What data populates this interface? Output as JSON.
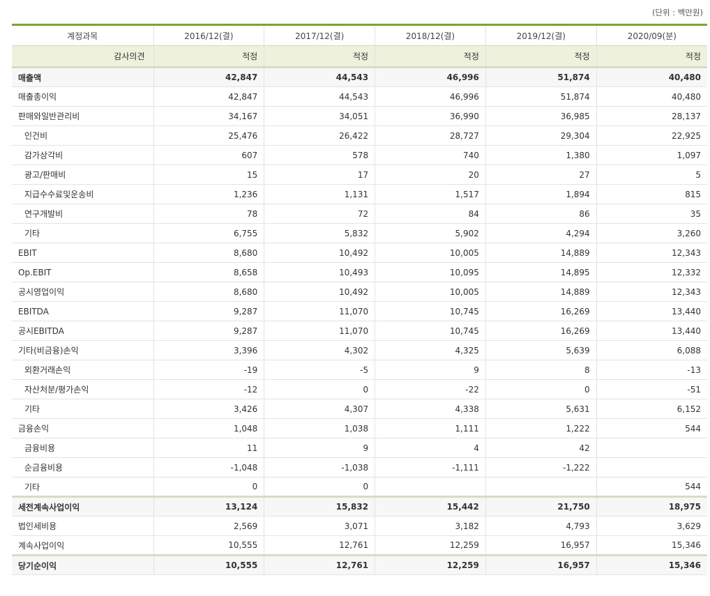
{
  "unit_label": "(단위 : 백만원)",
  "header": {
    "account_label": "계정과목",
    "periods": [
      "2016/12(결)",
      "2017/12(결)",
      "2018/12(결)",
      "2019/12(결)",
      "2020/09(분)"
    ]
  },
  "audit": {
    "label": "감사의견",
    "values": [
      "적정",
      "적정",
      "적정",
      "적정",
      "적정"
    ]
  },
  "rows": [
    {
      "label": "매출액",
      "level": 0,
      "bold": true,
      "values": [
        "42,847",
        "44,543",
        "46,996",
        "51,874",
        "40,480"
      ]
    },
    {
      "label": "매출총이익",
      "level": 0,
      "values": [
        "42,847",
        "44,543",
        "46,996",
        "51,874",
        "40,480"
      ]
    },
    {
      "label": "판매와일반관리비",
      "level": 0,
      "values": [
        "34,167",
        "34,051",
        "36,990",
        "36,985",
        "28,137"
      ]
    },
    {
      "label": "인건비",
      "level": 1,
      "values": [
        "25,476",
        "26,422",
        "28,727",
        "29,304",
        "22,925"
      ]
    },
    {
      "label": "감가상각비",
      "level": 1,
      "values": [
        "607",
        "578",
        "740",
        "1,380",
        "1,097"
      ]
    },
    {
      "label": "광고/판매비",
      "level": 1,
      "values": [
        "15",
        "17",
        "20",
        "27",
        "5"
      ]
    },
    {
      "label": "지급수수료및운송비",
      "level": 1,
      "values": [
        "1,236",
        "1,131",
        "1,517",
        "1,894",
        "815"
      ]
    },
    {
      "label": "연구개발비",
      "level": 1,
      "values": [
        "78",
        "72",
        "84",
        "86",
        "35"
      ]
    },
    {
      "label": "기타",
      "level": 1,
      "values": [
        "6,755",
        "5,832",
        "5,902",
        "4,294",
        "3,260"
      ]
    },
    {
      "label": "EBIT",
      "level": 0,
      "values": [
        "8,680",
        "10,492",
        "10,005",
        "14,889",
        "12,343"
      ]
    },
    {
      "label": "Op.EBIT",
      "level": 0,
      "values": [
        "8,658",
        "10,493",
        "10,095",
        "14,895",
        "12,332"
      ]
    },
    {
      "label": "공시영업이익",
      "level": 0,
      "values": [
        "8,680",
        "10,492",
        "10,005",
        "14,889",
        "12,343"
      ]
    },
    {
      "label": "EBITDA",
      "level": 0,
      "values": [
        "9,287",
        "11,070",
        "10,745",
        "16,269",
        "13,440"
      ]
    },
    {
      "label": "공시EBITDA",
      "level": 0,
      "values": [
        "9,287",
        "11,070",
        "10,745",
        "16,269",
        "13,440"
      ]
    },
    {
      "label": "기타(비금융)손익",
      "level": 0,
      "values": [
        "3,396",
        "4,302",
        "4,325",
        "5,639",
        "6,088"
      ]
    },
    {
      "label": "외환거래손익",
      "level": 1,
      "values": [
        "-19",
        "-5",
        "9",
        "8",
        "-13"
      ]
    },
    {
      "label": "자산처분/평가손익",
      "level": 1,
      "values": [
        "-12",
        "0",
        "-22",
        "0",
        "-51"
      ]
    },
    {
      "label": "기타",
      "level": 1,
      "values": [
        "3,426",
        "4,307",
        "4,338",
        "5,631",
        "6,152"
      ]
    },
    {
      "label": "금융손익",
      "level": 0,
      "values": [
        "1,048",
        "1,038",
        "1,111",
        "1,222",
        "544"
      ]
    },
    {
      "label": "금융비용",
      "level": 1,
      "values": [
        "11",
        "9",
        "4",
        "42",
        ""
      ]
    },
    {
      "label": "순금융비용",
      "level": 1,
      "values": [
        "-1,048",
        "-1,038",
        "-1,111",
        "-1,222",
        ""
      ]
    },
    {
      "label": "기타",
      "level": 1,
      "values": [
        "0",
        "0",
        "",
        "",
        "544"
      ]
    },
    {
      "label": "세전계속사업이익",
      "level": 0,
      "bold": true,
      "sepTop": true,
      "values": [
        "13,124",
        "15,832",
        "15,442",
        "21,750",
        "18,975"
      ]
    },
    {
      "label": "법인세비용",
      "level": 0,
      "values": [
        "2,569",
        "3,071",
        "3,182",
        "4,793",
        "3,629"
      ]
    },
    {
      "label": "계속사업이익",
      "level": 0,
      "values": [
        "10,555",
        "12,761",
        "12,259",
        "16,957",
        "15,346"
      ]
    },
    {
      "label": "당기순이익",
      "level": 0,
      "bold": true,
      "sepTop": true,
      "values": [
        "10,555",
        "12,761",
        "12,259",
        "16,957",
        "15,346"
      ]
    }
  ]
}
